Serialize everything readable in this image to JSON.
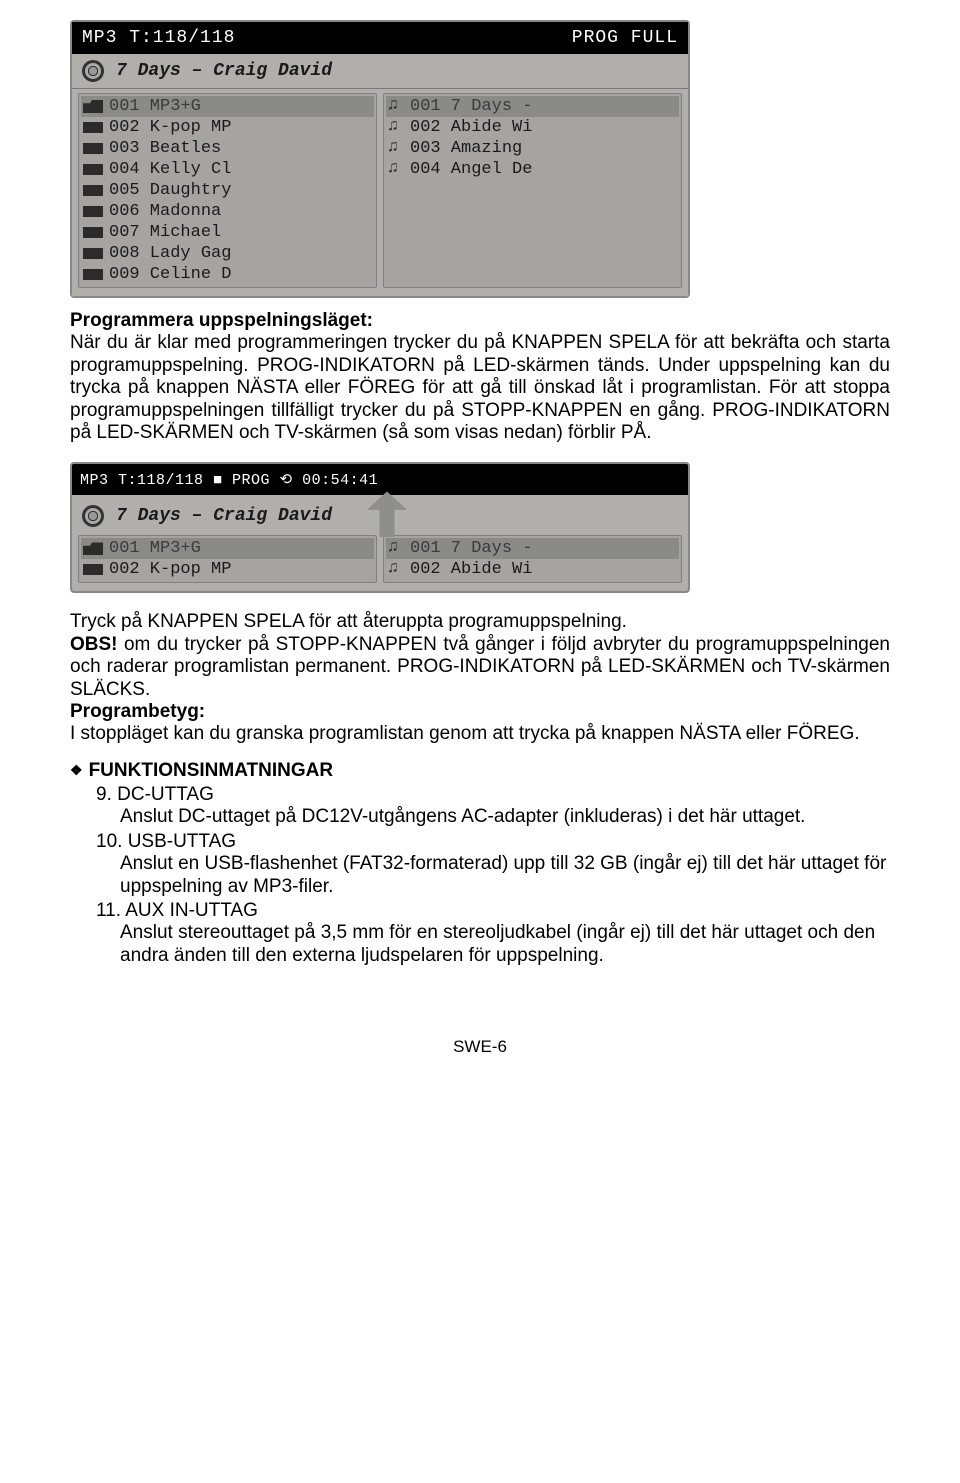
{
  "screen1": {
    "header_left": "MP3   T:118/118",
    "header_right": "PROG FULL",
    "now_playing": "7 Days – Craig David",
    "left": [
      {
        "icon": "folder",
        "num": "001",
        "label": "MP3+G",
        "hl": true
      },
      {
        "icon": "bar",
        "num": "002",
        "label": "K-pop MP"
      },
      {
        "icon": "bar",
        "num": "003",
        "label": "Beatles"
      },
      {
        "icon": "bar",
        "num": "004",
        "label": "Kelly Cl"
      },
      {
        "icon": "bar",
        "num": "005",
        "label": "Daughtry"
      },
      {
        "icon": "bar",
        "num": "006",
        "label": "Madonna"
      },
      {
        "icon": "bar",
        "num": "007",
        "label": "Michael"
      },
      {
        "icon": "bar",
        "num": "008",
        "label": "Lady Gag"
      },
      {
        "icon": "bar",
        "num": "009",
        "label": "Celine D"
      }
    ],
    "right": [
      {
        "icon": "note",
        "num": "001",
        "label": "7 Days -",
        "hl": true
      },
      {
        "icon": "note",
        "num": "002",
        "label": "Abide Wi"
      },
      {
        "icon": "note",
        "num": "003",
        "label": "Amazing"
      },
      {
        "icon": "note",
        "num": "004",
        "label": "Angel De"
      }
    ]
  },
  "para1_heading": "Programmera uppspelningsläget:",
  "para1_body": "När du är klar med programmeringen trycker du på KNAPPEN SPELA för att bekräfta och starta programuppspelning. PROG-INDIKATORN på LED-skärmen tänds. Under uppspelning kan du trycka på knappen NÄSTA eller FÖREG för att gå till önskad låt i programlistan. För att stoppa programuppspelningen tillfälligt trycker du på STOPP-KNAPPEN en gång. PROG-INDIKATORN på LED-SKÄRMEN och TV-skärmen (så som visas nedan) förblir PÅ.",
  "screen2": {
    "header_left": "MP3   T:118/118  ■   PROG  ⟲ 00:54:41",
    "now_playing": "7 Days – Craig David",
    "left": [
      {
        "icon": "folder",
        "num": "001",
        "label": "MP3+G",
        "hl": true
      },
      {
        "icon": "bar",
        "num": "002",
        "label": "K-pop MP"
      }
    ],
    "right": [
      {
        "icon": "note",
        "num": "001",
        "label": "7 Days -",
        "hl": true
      },
      {
        "icon": "note",
        "num": "002",
        "label": "Abide Wi"
      }
    ]
  },
  "para2_line1": "Tryck på KNAPPEN SPELA för att återuppta programuppspelning.",
  "para2_obs_label": "OBS!",
  "para2_obs_body": " om du trycker på STOPP-KNAPPEN två gånger i följd avbryter du programuppspelningen och raderar programlistan permanent. PROG-INDIKATORN på LED-SKÄRMEN och TV-skärmen SLÄCKS.",
  "para2_heading2": "Programbetyg:",
  "para2_body2": "I stoppläget kan du granska programlistan genom att trycka på knappen NÄSTA eller FÖREG.",
  "func_heading": "FUNKTIONSINMATNINGAR",
  "func_items": [
    {
      "num": "9.",
      "title": "DC-UTTAG",
      "body": "Anslut DC-uttaget på DC12V-utgångens AC-adapter (inkluderas) i det här uttaget."
    },
    {
      "num": "10.",
      "title": "USB-UTTAG",
      "body": "Anslut en USB-flashenhet (FAT32-formaterad) upp till 32 GB (ingår ej) till det här uttaget för uppspelning av MP3-filer."
    },
    {
      "num": "11.",
      "title": "AUX IN-UTTAG",
      "body": "Anslut stereouttaget på 3,5 mm för en stereoljudkabel (ingår ej) till det här uttaget och den andra änden till den externa ljudspelaren för uppspelning."
    }
  ],
  "page_number": "SWE-6"
}
